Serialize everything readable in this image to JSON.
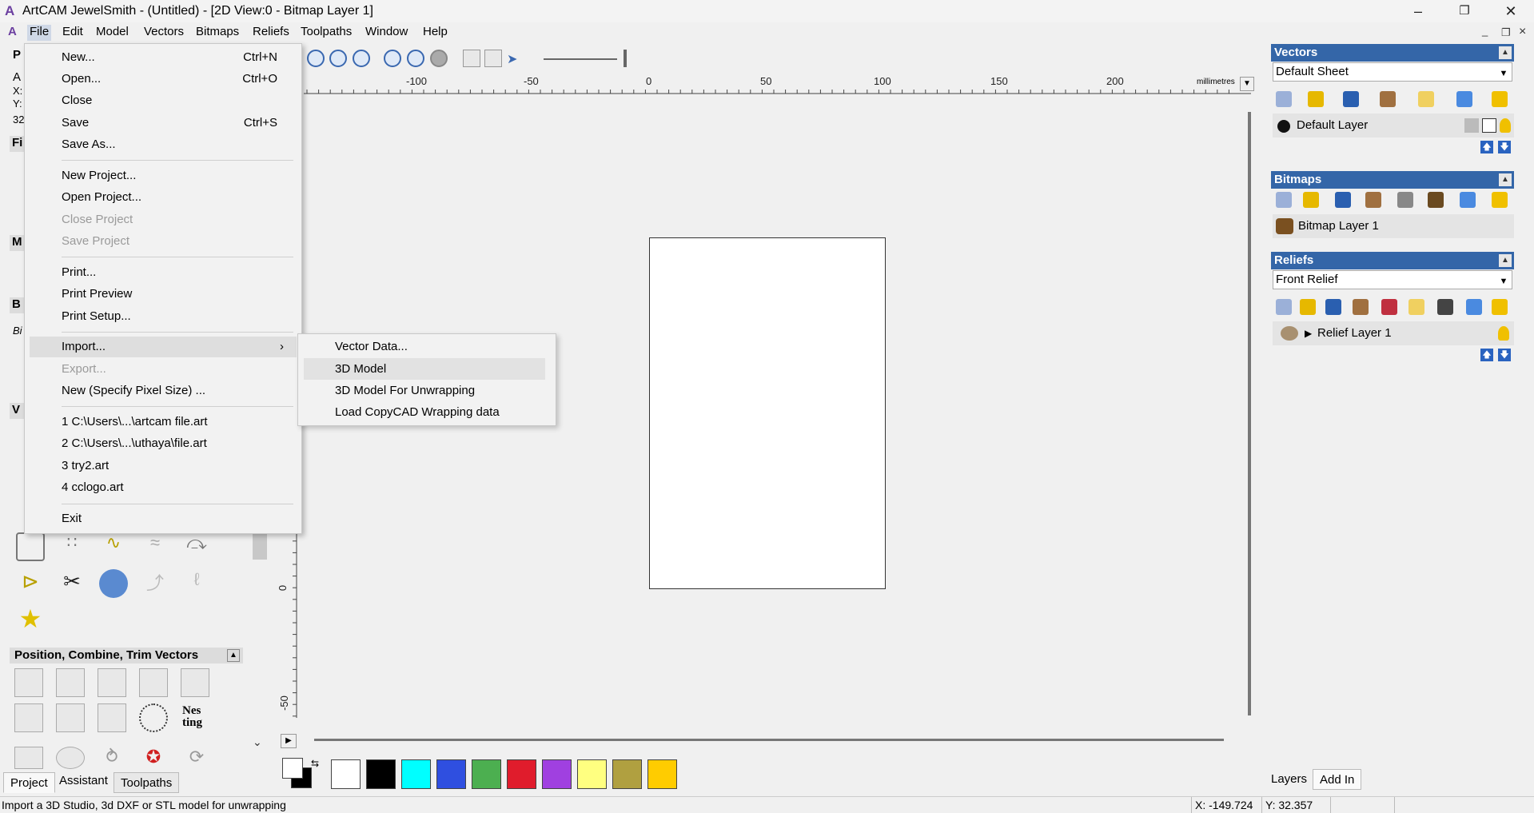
{
  "window": {
    "title": "ArtCAM JewelSmith - (Untitled) - [2D View:0 - Bitmap Layer 1]",
    "min_glyph": "–",
    "max_glyph": "❐",
    "close_glyph": "✕"
  },
  "menubar": {
    "items": [
      "File",
      "Edit",
      "Model",
      "Vectors",
      "Bitmaps",
      "Reliefs",
      "Toolpaths",
      "Window",
      "Help"
    ],
    "mdi_min": "_",
    "mdi_restore": "❐",
    "mdi_close": "×"
  },
  "file_menu": {
    "new": "New...",
    "new_sc": "Ctrl+N",
    "open": "Open...",
    "open_sc": "Ctrl+O",
    "close": "Close",
    "save": "Save",
    "save_sc": "Ctrl+S",
    "save_as": "Save As...",
    "new_project": "New Project...",
    "open_project": "Open Project...",
    "close_project": "Close Project",
    "save_project": "Save Project",
    "print": "Print...",
    "print_preview": "Print Preview",
    "print_setup": "Print Setup...",
    "import": "Import...",
    "export": "Export...",
    "new_pixel": "New (Specify Pixel Size) ...",
    "recent1": "1 C:\\Users\\...\\artcam file.art",
    "recent2": "2 C:\\Users\\...\\uthaya\\file.art",
    "recent3": "3 try2.art",
    "recent4": "4 cclogo.art",
    "exit": "Exit"
  },
  "import_submenu": {
    "vector_data": "Vector Data...",
    "model_3d": "3D Model",
    "model_unwrap": "3D Model For Unwrapping",
    "copycad": "Load CopyCAD Wrapping data"
  },
  "ruler": {
    "h_labels": [
      "-100",
      "-50",
      "0",
      "50",
      "100",
      "150",
      "200"
    ],
    "unit": "millimetres",
    "v_labels": [
      "0",
      "-50"
    ]
  },
  "left_panel": {
    "partial_labels": [
      "P",
      "A",
      "X:",
      "Y:",
      "32",
      "Fi",
      "M",
      "B",
      "Bi",
      "V"
    ],
    "section_position": "Position, Combine, Trim Vectors",
    "nesting_label": "Nes ting"
  },
  "right_panel": {
    "vectors": {
      "header": "Vectors",
      "sheet": "Default Sheet",
      "layer": "Default Layer"
    },
    "bitmaps": {
      "header": "Bitmaps",
      "layer": "Bitmap Layer 1"
    },
    "reliefs": {
      "header": "Reliefs",
      "relief": "Front Relief",
      "layer": "Relief Layer 1"
    }
  },
  "bottom_tabs_left": [
    "Project",
    "Assistant",
    "Toolpaths"
  ],
  "bottom_tabs_right": [
    "Layers",
    "Add In"
  ],
  "swatches": [
    "#ffffff",
    "#000000",
    "#00ffff",
    "#2f4fe0",
    "#4caf50",
    "#e01c2c",
    "#a040e0",
    "#ffff80",
    "#b0a040",
    "#ffcc00"
  ],
  "status": {
    "message": "Import a 3D Studio, 3d DXF or STL model for unwrapping",
    "x": "X: -149.724",
    "y": "Y: 32.357"
  }
}
